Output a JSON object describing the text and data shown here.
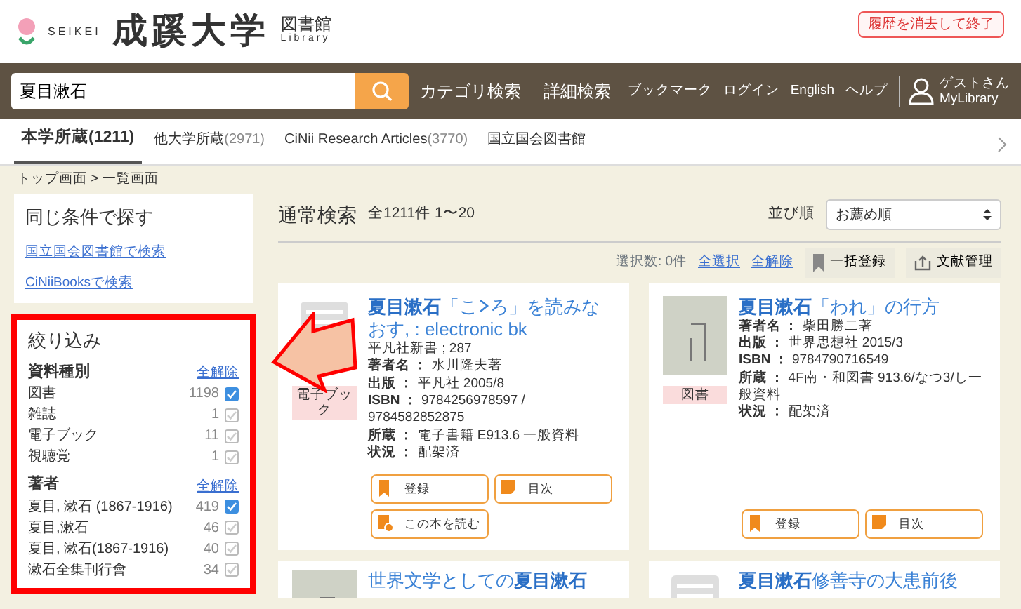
{
  "header": {
    "logo_latin": "SEIKEI",
    "logo_name": "成蹊大学",
    "logo_sub": "図書館",
    "logo_sub_latin": "Library",
    "exit_button": "履歴を消去して終了"
  },
  "navbar": {
    "search_value": "夏目漱石",
    "links": [
      "カテゴリ検索",
      "詳細検索"
    ],
    "small_links": [
      "ブックマーク",
      "ログイン",
      "English",
      "ヘルプ"
    ],
    "user_line1": "ゲストさん",
    "user_line2": "MyLibrary"
  },
  "tabs": [
    {
      "label": "本学所蔵",
      "count": "(1211)",
      "selected": true
    },
    {
      "label": "他大学所蔵",
      "count": "(2971)",
      "selected": false
    },
    {
      "label": "CiNii Research Articles",
      "count": "(3770)",
      "selected": false
    },
    {
      "label": "国立国会図書館",
      "selected": false
    }
  ],
  "breadcrumb": "トップ画面 > 一覧画面",
  "same_conditions": {
    "title": "同じ条件で探す",
    "links": [
      "国立国会図書館で検索",
      "CiNiiBooksで検索"
    ]
  },
  "filter": {
    "title": "絞り込み",
    "groups": [
      {
        "title": "資料種別",
        "clear": "全解除",
        "items": [
          {
            "label": "図書",
            "count": "1198",
            "checked": true
          },
          {
            "label": "雑誌",
            "count": "1",
            "checked": false
          },
          {
            "label": "電子ブック",
            "count": "11",
            "checked": false
          },
          {
            "label": "視聴覚",
            "count": "1",
            "checked": false
          }
        ]
      },
      {
        "title": "著者",
        "clear": "全解除",
        "items": [
          {
            "label": "夏目, 漱石 (1867-1916)",
            "count": "419",
            "checked": true
          },
          {
            "label": "夏目,漱石",
            "count": "46",
            "checked": false
          },
          {
            "label": "夏目, 漱石(1867-1916)",
            "count": "40",
            "checked": false
          },
          {
            "label": "漱石全集刊行會",
            "count": "34",
            "checked": false
          }
        ]
      }
    ]
  },
  "results": {
    "title": "通常検索",
    "summary": "全1211件 1〜20",
    "sort_label": "並び順",
    "sort_value": "お薦め順",
    "selected_count": "選択数: 0件",
    "select_all": "全選択",
    "clear_all": "全解除",
    "bulk_register": "一括登録",
    "reference_manager": "文献管理",
    "items": [
      {
        "kind": "ebook",
        "type_label": "電子ブック",
        "title": "**夏目漱石**「こ",
        "title_rest": "ろ」を読みなおす, : electronic bk",
        "fields": [
          {
            "value": "平凡社新書 ; 287"
          },
          {
            "label": "著者名 ：",
            "value": "水川隆夫著"
          },
          {
            "label": "出版 ：",
            "value": "平凡社 2005/8"
          },
          {
            "label": "ISBN ：",
            "value": "9784256978597 / 9784582852875"
          },
          {
            "label": "所蔵 ：",
            "value": "電子書籍 E913.6 一般資料"
          },
          {
            "label": "状況 ：",
            "value": "配架済"
          }
        ],
        "buttons": [
          {
            "kind": "bookmark",
            "label": "登録"
          },
          {
            "kind": "toc",
            "label": "目次"
          },
          {
            "kind": "read",
            "label": "この本を読む"
          }
        ]
      },
      {
        "kind": "book",
        "type_label": "図書",
        "title": "**夏目漱石**「われ」の行方",
        "fields": [
          {
            "label": "著者名 ：",
            "value": "柴田勝二著"
          },
          {
            "label": "出版 ：",
            "value": "世界思想社 2015/3"
          },
          {
            "label": "ISBN ：",
            "value": "9784790716549"
          },
          {
            "label": "所蔵 ：",
            "value": "4F南・和図書 913.6/なつ3/し一般資料"
          },
          {
            "label": "状況 ：",
            "value": "配架済"
          }
        ],
        "buttons": [
          {
            "kind": "bookmark",
            "label": "登録"
          },
          {
            "kind": "toc",
            "label": "目次"
          }
        ]
      },
      {
        "kind": "book",
        "title": "世界文学としての**夏目漱石**"
      },
      {
        "kind": "ebook",
        "title": "**夏目漱石**修善寺の大患前後"
      }
    ]
  }
}
